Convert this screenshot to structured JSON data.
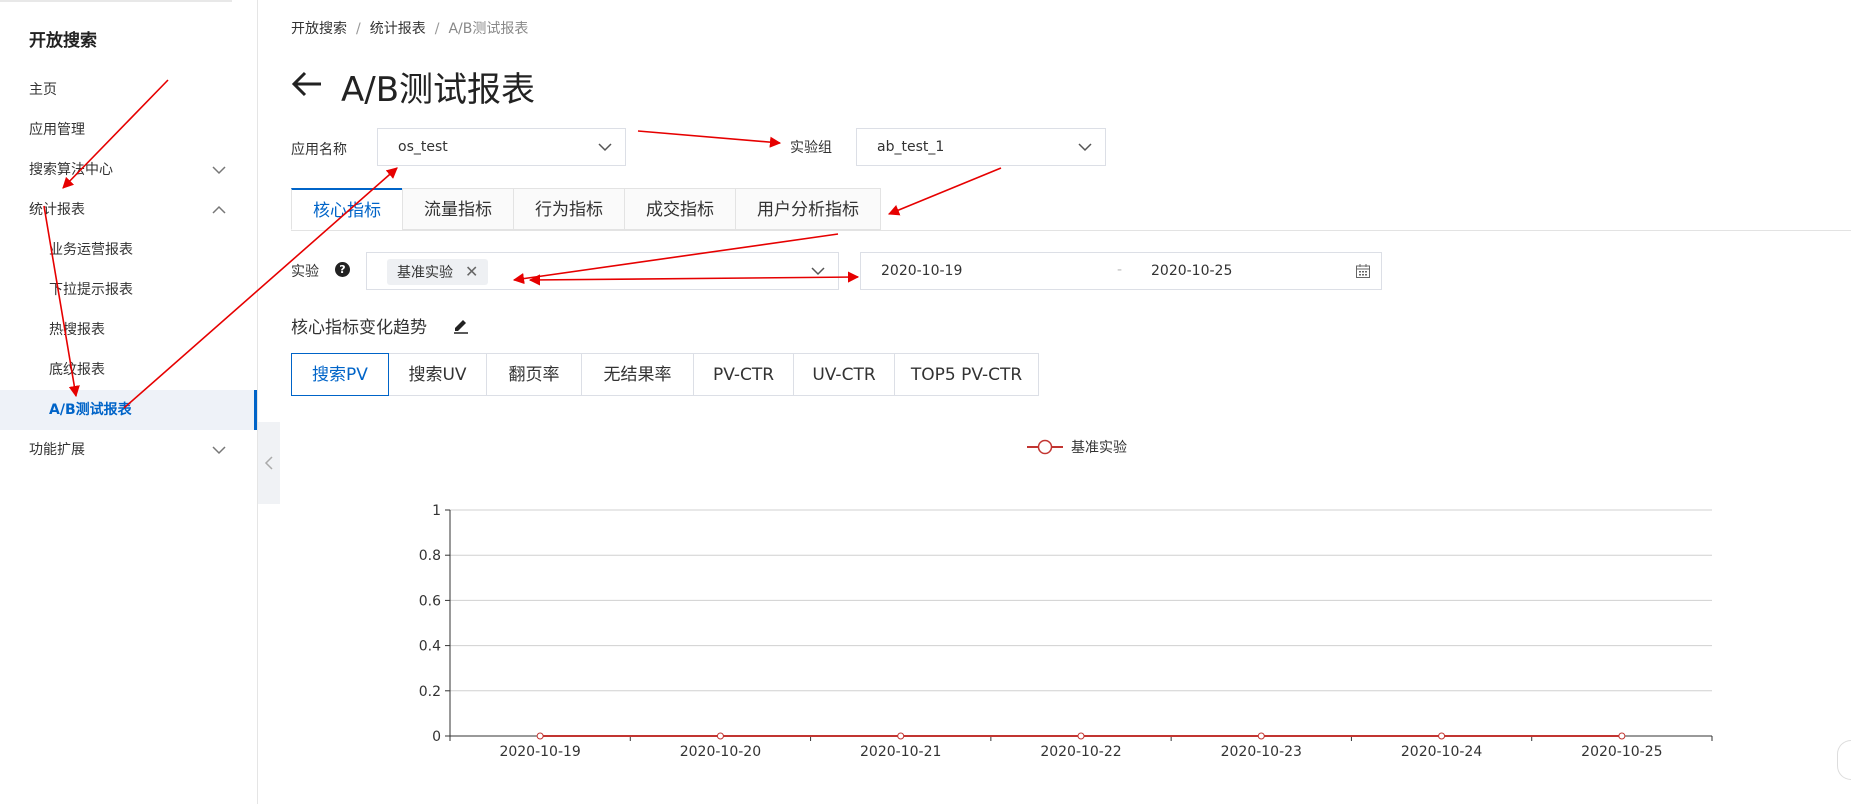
{
  "sidebar": {
    "title": "开放搜索",
    "items": [
      {
        "label": "主页"
      },
      {
        "label": "应用管理"
      },
      {
        "label": "搜索算法中心"
      },
      {
        "label": "统计报表"
      },
      {
        "label": "业务运营报表"
      },
      {
        "label": "下拉提示报表"
      },
      {
        "label": "热搜报表"
      },
      {
        "label": "底纹报表"
      },
      {
        "label": "A/B测试报表"
      },
      {
        "label": "功能扩展"
      }
    ]
  },
  "breadcrumb": [
    "开放搜索",
    "统计报表",
    "A/B测试报表"
  ],
  "page": {
    "title": "A/B测试报表"
  },
  "filters": {
    "app_label": "应用名称",
    "app_value": "os_test",
    "group_label": "实验组",
    "group_value": "ab_test_1",
    "experiment_label": "实验",
    "experiment_tag": "基准实验",
    "date_start": "2020-10-19",
    "date_sep": "-",
    "date_end": "2020-10-25"
  },
  "tabs": [
    "核心指标",
    "流量指标",
    "行为指标",
    "成交指标",
    "用户分析指标"
  ],
  "section": {
    "title": "核心指标变化趋势"
  },
  "metric_tabs": [
    "搜索PV",
    "搜索UV",
    "翻页率",
    "无结果率",
    "PV-CTR",
    "UV-CTR",
    "TOP5 PV-CTR"
  ],
  "colors": {
    "accent": "#0064c8",
    "series": "#c23531",
    "annotation_arrow": "#e60000"
  },
  "chart_data": {
    "type": "line",
    "title": "",
    "xlabel": "",
    "ylabel": "",
    "x": [
      "2020-10-19",
      "2020-10-20",
      "2020-10-21",
      "2020-10-22",
      "2020-10-23",
      "2020-10-24",
      "2020-10-25"
    ],
    "series": [
      {
        "name": "基准实验",
        "values": [
          0,
          0,
          0,
          0,
          0,
          0,
          0
        ]
      }
    ],
    "ylim": [
      0,
      1
    ],
    "yticks": [
      "0",
      "0.2",
      "0.4",
      "0.6",
      "0.8",
      "1"
    ],
    "grid": true,
    "legend": "top-center"
  }
}
